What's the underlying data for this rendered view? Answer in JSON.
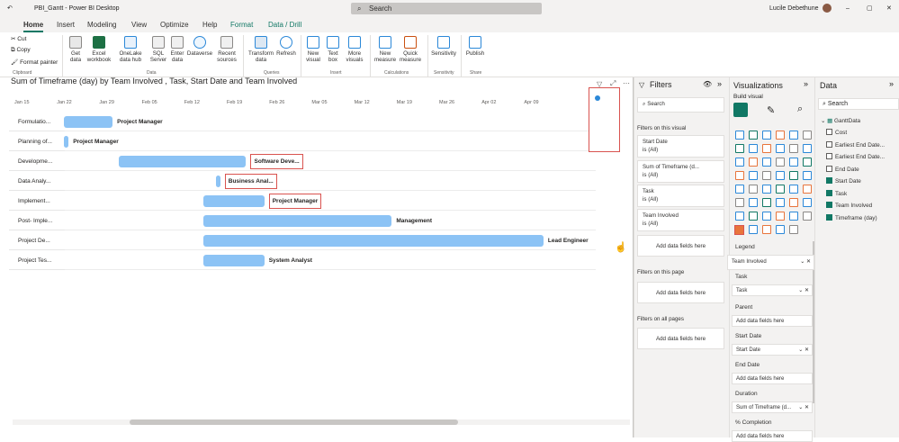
{
  "window": {
    "title": "PBI_Gantt - Power BI Desktop",
    "search_placeholder": "Search",
    "user": "Lucile Debethune"
  },
  "tabs": [
    "Home",
    "Insert",
    "Modeling",
    "View",
    "Optimize",
    "Help",
    "Format",
    "Data / Drill"
  ],
  "ribbon": {
    "clipboard": [
      "Cut",
      "Copy",
      "Format painter"
    ],
    "buttons": [
      "Get data",
      "Excel workbook",
      "OneLake data hub",
      "SQL Server",
      "Enter data",
      "Dataverse",
      "Recent sources",
      "Transform data",
      "Refresh",
      "New visual",
      "Text box",
      "More visuals",
      "New measure",
      "Quick measure",
      "Sensitivity",
      "Publish"
    ],
    "groups": [
      "Clipboard",
      "Data",
      "Queries",
      "Insert",
      "Calculations",
      "Sensitivity",
      "Share"
    ]
  },
  "chart": {
    "title": "Sum of Timeframe (day) by Team Involved , Task, Start Date and Team Involved",
    "x_ticks": [
      "Jan 15",
      "Jan 22",
      "Jan 29",
      "Feb 05",
      "Feb 12",
      "Feb 19",
      "Feb 26",
      "Mar 05",
      "Mar 12",
      "Mar 19",
      "Mar 26",
      "Apr 02",
      "Apr 09"
    ]
  },
  "chart_data": {
    "type": "bar",
    "categories": [
      "Formulatio...",
      "Planning of...",
      "Developme...",
      "Data Analy...",
      "Implement...",
      "Post- Imple...",
      "Project De...",
      "Project Tes..."
    ],
    "series": [
      {
        "start": [
          "Jan 22",
          "Jan 22",
          "Jan 31",
          "Feb 16",
          "Feb 14",
          "Feb 14",
          "Feb 14",
          "Feb 14"
        ],
        "end": [
          "Jan 30",
          "Jan 22",
          "Feb 21",
          "Feb 16",
          "Feb 24",
          "Mar 16",
          "Apr 10",
          "Feb 24"
        ],
        "labels": [
          "Project Manager",
          "Project Manager",
          "Software Deve...",
          "Business Anal...",
          "Project Manager",
          "Management",
          "Lead Engineer",
          "System Analyst"
        ]
      }
    ],
    "xlim": [
      "Jan 15",
      "Apr 09"
    ]
  },
  "filters": {
    "title": "Filters",
    "search": "Search",
    "on_visual": "Filters on this visual",
    "cards": [
      {
        "name": "Start Date",
        "value": "is (All)"
      },
      {
        "name": "Sum of Timeframe (d...",
        "value": "is (All)"
      },
      {
        "name": "Task",
        "value": "is (All)"
      },
      {
        "name": "Team Involved",
        "value": "is (All)"
      }
    ],
    "add": "Add data fields here",
    "on_page": "Filters on this page",
    "on_all": "Filters on all pages"
  },
  "viz": {
    "title": "Visualizations",
    "build": "Build visual",
    "wells": [
      {
        "label": "Legend",
        "value": "Team Involved"
      },
      {
        "label": "Task",
        "value": "Task"
      },
      {
        "label": "Parent",
        "value": "Add data fields here"
      },
      {
        "label": "Start Date",
        "value": "Start Date"
      },
      {
        "label": "End Date",
        "value": "Add data fields here"
      },
      {
        "label": "Duration",
        "value": "Sum of Timeframe (d..."
      },
      {
        "label": "% Completion",
        "value": "Add data fields here"
      }
    ]
  },
  "data": {
    "title": "Data",
    "search": "Search",
    "table": "GanttData",
    "fields": [
      {
        "name": "Cost",
        "checked": false
      },
      {
        "name": "Earliest End Date...",
        "checked": false
      },
      {
        "name": "Earliest End Date...",
        "checked": false
      },
      {
        "name": "End Date",
        "checked": false
      },
      {
        "name": "Start Date",
        "checked": true
      },
      {
        "name": "Task",
        "checked": true
      },
      {
        "name": "Team Involved",
        "checked": true
      },
      {
        "name": "Timeframe (day)",
        "checked": true
      }
    ]
  }
}
